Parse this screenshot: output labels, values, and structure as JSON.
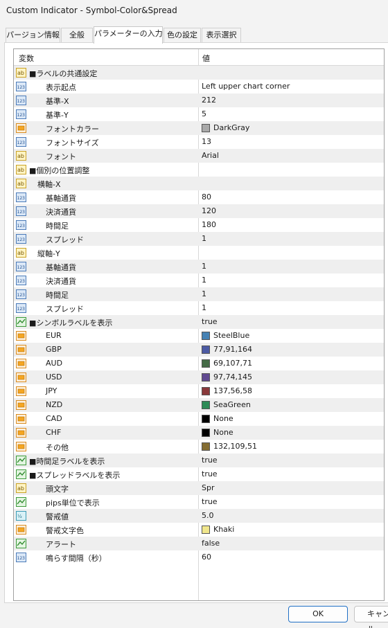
{
  "window": {
    "title": "Custom Indicator - Symbol-Color&Spread"
  },
  "tabs": [
    {
      "label": "パージョン情報"
    },
    {
      "label": "全般"
    },
    {
      "label": "パラメーターの入力"
    },
    {
      "label": "色の設定"
    },
    {
      "label": "表示選択"
    }
  ],
  "grid": {
    "col_variable": "変数",
    "col_value": "値",
    "rows": [
      {
        "type": "ab",
        "indent": 0,
        "name": "■ラベルの共通設定",
        "value": ""
      },
      {
        "type": "123",
        "indent": 2,
        "name": "表示起点",
        "value": "Left upper chart corner"
      },
      {
        "type": "123",
        "indent": 2,
        "name": "基準-X",
        "value": "212"
      },
      {
        "type": "123",
        "indent": 2,
        "name": "基準-Y",
        "value": "5"
      },
      {
        "type": "color",
        "indent": 2,
        "name": "フォントカラー",
        "value": "DarkGray",
        "swatch": "#a9a9a9"
      },
      {
        "type": "123",
        "indent": 2,
        "name": "フォントサイズ",
        "value": "13"
      },
      {
        "type": "ab",
        "indent": 2,
        "name": "フォント",
        "value": "Arial"
      },
      {
        "type": "ab",
        "indent": 0,
        "name": "■個別の位置調整",
        "value": ""
      },
      {
        "type": "ab",
        "indent": 1,
        "name": "横軸-X",
        "value": ""
      },
      {
        "type": "123",
        "indent": 2,
        "name": "基軸通貨",
        "value": "80"
      },
      {
        "type": "123",
        "indent": 2,
        "name": "決済通貨",
        "value": "120"
      },
      {
        "type": "123",
        "indent": 2,
        "name": "時間足",
        "value": "180"
      },
      {
        "type": "123",
        "indent": 2,
        "name": "スプレッド",
        "value": "1"
      },
      {
        "type": "ab",
        "indent": 1,
        "name": "縦軸-Y",
        "value": ""
      },
      {
        "type": "123",
        "indent": 2,
        "name": "基軸通貨",
        "value": "1"
      },
      {
        "type": "123",
        "indent": 2,
        "name": "決済通貨",
        "value": "1"
      },
      {
        "type": "123",
        "indent": 2,
        "name": "時間足",
        "value": "1"
      },
      {
        "type": "123",
        "indent": 2,
        "name": "スプレッド",
        "value": "1"
      },
      {
        "type": "bool",
        "indent": 0,
        "name": "■シンボルラベルを表示",
        "value": "true"
      },
      {
        "type": "color",
        "indent": 2,
        "name": "EUR",
        "value": "SteelBlue",
        "swatch": "#4682b4"
      },
      {
        "type": "color",
        "indent": 2,
        "name": "GBP",
        "value": "77,91,164",
        "swatch": "#4d5ba4"
      },
      {
        "type": "color",
        "indent": 2,
        "name": "AUD",
        "value": "69,107,71",
        "swatch": "#456b47"
      },
      {
        "type": "color",
        "indent": 2,
        "name": "USD",
        "value": "97,74,145",
        "swatch": "#614a91"
      },
      {
        "type": "color",
        "indent": 2,
        "name": "JPY",
        "value": "137,56,58",
        "swatch": "#89383a"
      },
      {
        "type": "color",
        "indent": 2,
        "name": "NZD",
        "value": "SeaGreen",
        "swatch": "#2e8b57"
      },
      {
        "type": "color",
        "indent": 2,
        "name": "CAD",
        "value": "None",
        "swatch": "#000000"
      },
      {
        "type": "color",
        "indent": 2,
        "name": "CHF",
        "value": "None",
        "swatch": "#000000"
      },
      {
        "type": "color",
        "indent": 2,
        "name": "その他",
        "value": "132,109,51",
        "swatch": "#846d33"
      },
      {
        "type": "bool",
        "indent": 0,
        "name": "■時間足ラベルを表示",
        "value": "true"
      },
      {
        "type": "bool",
        "indent": 0,
        "name": "■スプレッドラベルを表示",
        "value": "true"
      },
      {
        "type": "ab",
        "indent": 2,
        "name": "頭文字",
        "value": "Spr"
      },
      {
        "type": "bool",
        "indent": 2,
        "name": "pips単位で表示",
        "value": "true"
      },
      {
        "type": "float",
        "indent": 2,
        "name": "警戒値",
        "value": "5.0"
      },
      {
        "type": "color",
        "indent": 2,
        "name": "警戒文字色",
        "value": "Khaki",
        "swatch": "#f0e68c"
      },
      {
        "type": "bool",
        "indent": 2,
        "name": "アラート",
        "value": "false"
      },
      {
        "type": "123",
        "indent": 2,
        "name": "鳴らす間隔（秒）",
        "value": "60"
      }
    ]
  },
  "buttons": {
    "ok": "OK",
    "cancel": "キャンセル"
  },
  "colors": {
    "accent": "#1f6fc5",
    "row_alt": "#efefef"
  }
}
